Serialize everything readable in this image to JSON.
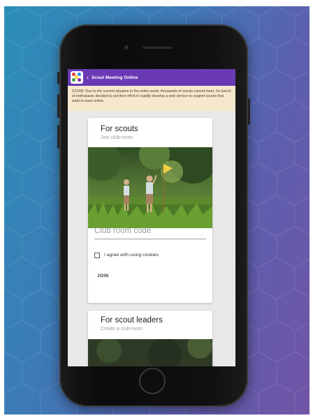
{
  "app": {
    "back_icon": "back-arrow-icon",
    "title": "Scout Meeting Online",
    "accent_color": "#6a3ab5"
  },
  "notice": {
    "text": "COVID: Due to the current situation in the entire world, thousands of scouts cannot meet. So bunch of enthusiasts decided to put their effort to rapidly develop a web service to support scouts that want to meet online.",
    "background_color": "#f6e8cd"
  },
  "scouts_card": {
    "title": "For scouts",
    "subtitle": "Join club-room",
    "club_code_placeholder": "Club room code",
    "cookie_consent_label": "I agree with using cookies",
    "cookie_consent_checked": false,
    "join_button_label": "JOIN"
  },
  "leaders_card": {
    "title": "For scout leaders",
    "subtitle": "Create a club-room"
  }
}
